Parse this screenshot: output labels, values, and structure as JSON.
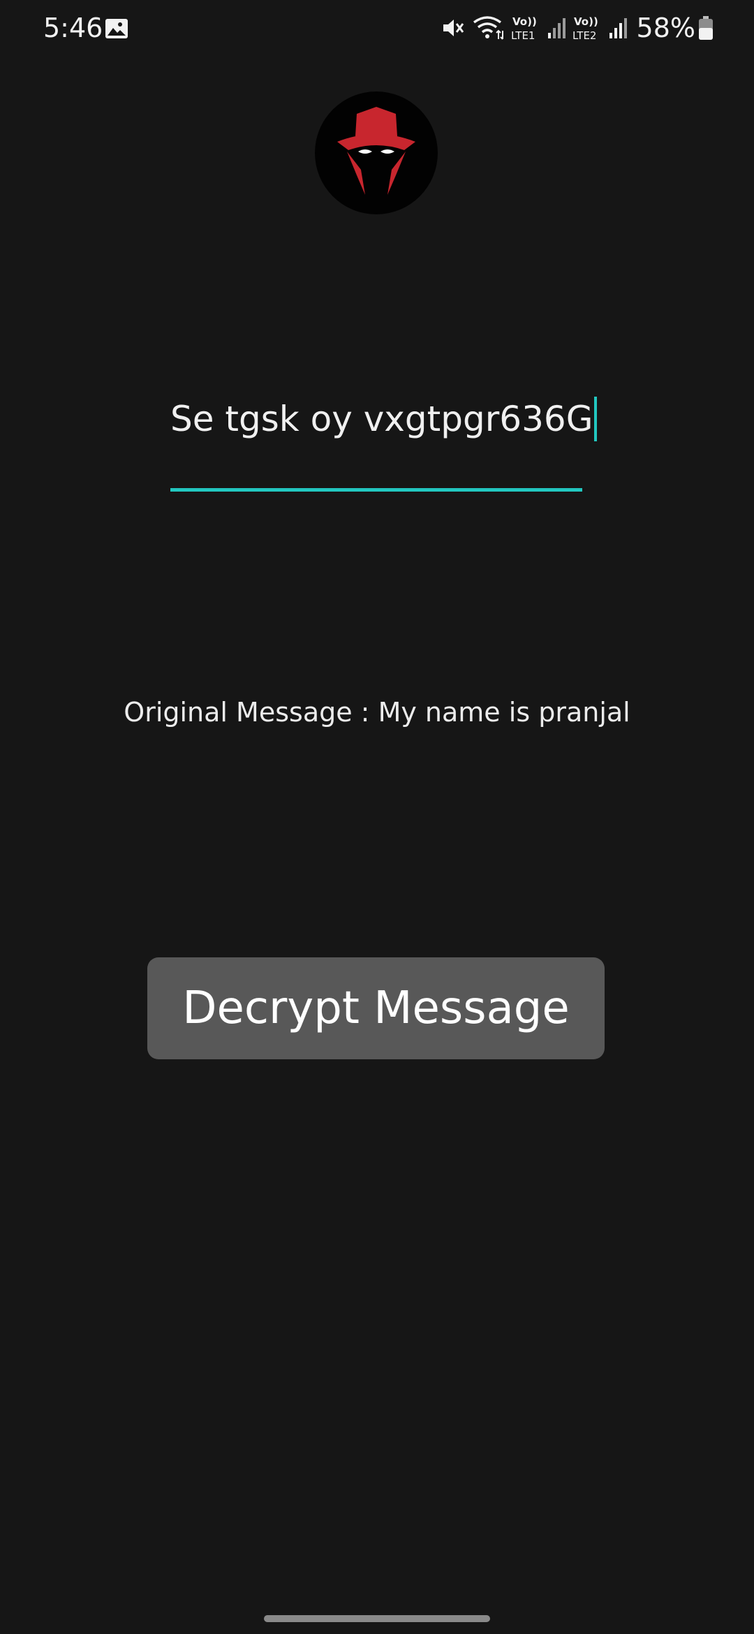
{
  "status_bar": {
    "time": "5:46",
    "battery_percent": "58%",
    "icons": [
      "gallery-icon",
      "mute-icon",
      "wifi-icon",
      "volte-lte1-icon",
      "signal-icon",
      "volte-lte2-icon",
      "signal-icon",
      "battery-icon"
    ]
  },
  "logo": {
    "icon": "spy-hat-logo-icon",
    "colors": {
      "hat": "#c8262e",
      "background": "#020202"
    }
  },
  "input": {
    "value": "Se tgsk oy vxgtpgr636G"
  },
  "result": {
    "text": "Original Message : My name is pranjal"
  },
  "actions": {
    "decrypt_label": "Decrypt Message"
  },
  "colors": {
    "accent": "#22c7c0",
    "background": "#161616",
    "button": "#585858"
  }
}
